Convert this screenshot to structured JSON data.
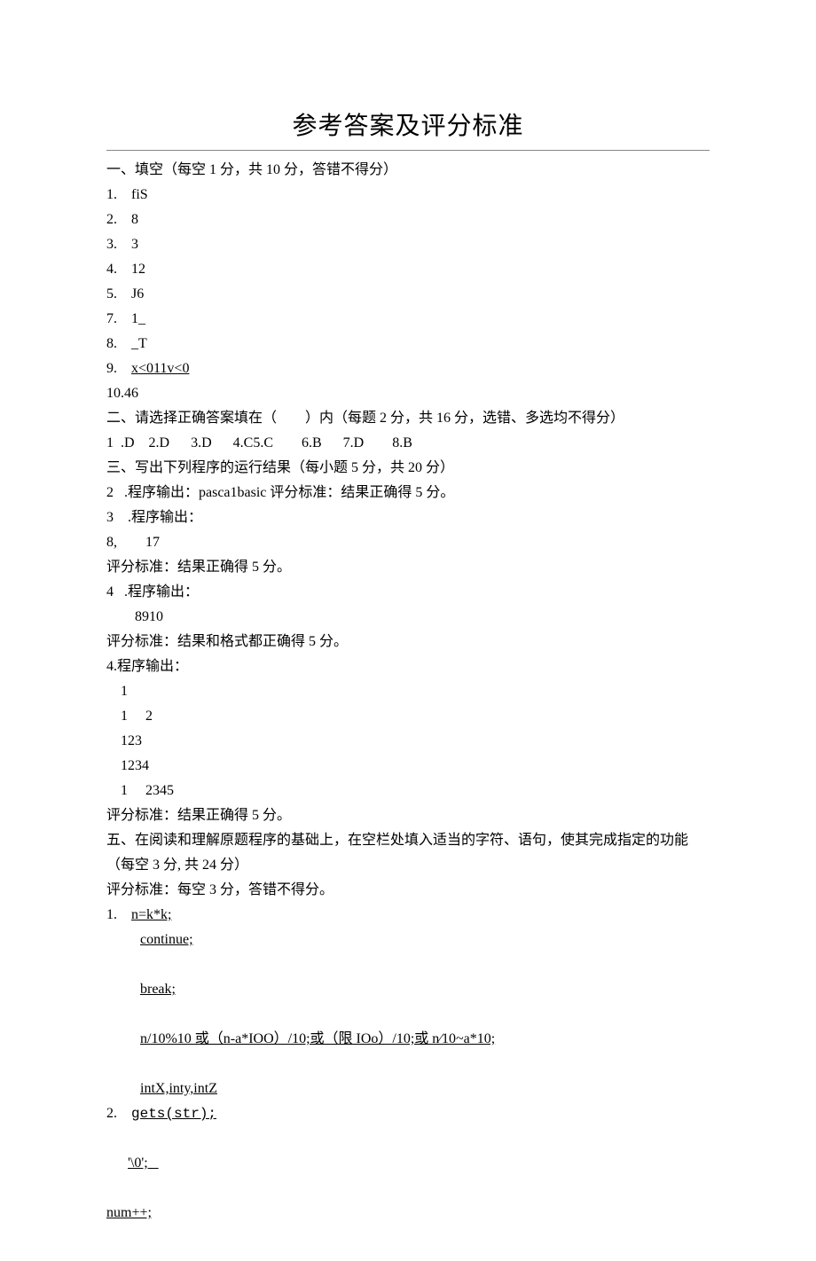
{
  "title": "参考答案及评分标准",
  "section1": {
    "heading": "一、填空（每空 1 分，共 10 分，答错不得分）",
    "items": [
      "1.    fiS",
      "2.    8",
      "3.    3",
      "4.    12",
      "5.    J6",
      "7.    1_",
      "8.    _T"
    ],
    "item9_prefix": "9.    ",
    "item9_u": "x<011v<0",
    "item10": "10.46"
  },
  "section2": {
    "heading": "二、请选择正确答案填在（        ）内（每题 2 分，共 16 分，选错、多选均不得分）",
    "answers": "1  .D    2.D      3.D      4.C5.C        6.B      7.D        8.B"
  },
  "section3": {
    "heading": "三、写出下列程序的运行结果（每小题 5 分，共 20 分）",
    "q2": "2   .程序输出：pasca1basic 评分标准：结果正确得 5 分。",
    "q3a": "3    .程序输出：",
    "q3b": "8,        17",
    "q3c": "评分标准：结果正确得 5 分。",
    "q4a": "4   .程序输出：",
    "q4b": "        8910",
    "q4c": "评分标准：结果和格式都正确得 5 分。",
    "q4_2a": "4.程序输出：",
    "q4_2_lines": [
      "    1",
      "    1     2",
      "    123",
      "    1234",
      "    1     2345"
    ],
    "q4_2c": "评分标准：结果正确得 5 分。"
  },
  "section5": {
    "heading1": "五、在阅读和理解原题程序的基础上，在空栏处填入适当的字符、语句，使其完成指定的功能",
    "heading2": "（每空 3 分, 共 24 分）",
    "rubric": "评分标准：每空 3 分，答错不得分。",
    "a1_prefix": "1.    ",
    "a1_u1": "n=k*k;",
    "a1_u2": "continue;",
    "a1_u3": "break;",
    "a1_u4": "n/10%10 或（n-a*IOO）/10;或（限 IOo）/10;或 n∕10~a*10;",
    "a1_u5": "intX,inty,intZ",
    "a2_prefix": "2.    ",
    "a2_u1": "gets(str);",
    "a2_u2": "'\\0';   ",
    "a2_u3": "num++;"
  }
}
